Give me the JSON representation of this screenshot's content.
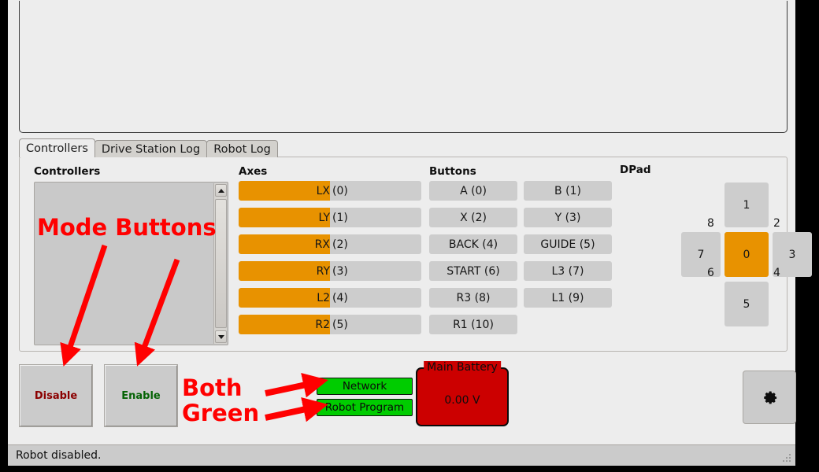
{
  "window": {
    "console_panel": "",
    "status_text": "Robot disabled."
  },
  "tabs": [
    {
      "label": "Controllers",
      "active": true
    },
    {
      "label": "Drive Station Log",
      "active": false
    },
    {
      "label": "Robot Log",
      "active": false
    }
  ],
  "controllers_group": {
    "title": "Controllers",
    "items": []
  },
  "axes_group": {
    "title": "Axes",
    "items": [
      {
        "name": "LX",
        "index": "(0)",
        "fill_pct": 50
      },
      {
        "name": "LY",
        "index": "(1)",
        "fill_pct": 50
      },
      {
        "name": "RX",
        "index": "(2)",
        "fill_pct": 50
      },
      {
        "name": "RY",
        "index": "(3)",
        "fill_pct": 50
      },
      {
        "name": "L2",
        "index": "(4)",
        "fill_pct": 50
      },
      {
        "name": "R2",
        "index": "(5)",
        "fill_pct": 50
      }
    ]
  },
  "buttons_group": {
    "title": "Buttons",
    "items": [
      "A (0)",
      "B (1)",
      "X (2)",
      "Y (3)",
      "BACK (4)",
      "GUIDE (5)",
      "START (6)",
      "L3 (7)",
      "R3 (8)",
      "L1 (9)",
      "R1 (10)"
    ]
  },
  "dpad_group": {
    "title": "DPad",
    "up": "1",
    "left": "7",
    "center": "0",
    "right": "3",
    "down": "5",
    "corner_top_left": "8",
    "corner_top_right": "2",
    "corner_bottom_left": "6",
    "corner_bottom_right": "4",
    "active": "center"
  },
  "mode_buttons": {
    "disable": "Disable",
    "enable": "Enable"
  },
  "status_leds": {
    "network": "Network",
    "robot_program": "Robot Program"
  },
  "battery": {
    "title": "Main Battery",
    "value": "0.00 V"
  },
  "settings_button": {
    "icon": "gear-icon"
  },
  "annotations": {
    "mode_buttons": "Mode Buttons",
    "both": "Both",
    "green": "Green"
  },
  "colors": {
    "axis_fill": "#e89200",
    "dpad_active": "#e89200",
    "led_green": "#00cc00",
    "battery_red": "#cc0000",
    "annotation_red": "#ff0000",
    "disable_text": "#8b0000",
    "enable_text": "#056305"
  }
}
